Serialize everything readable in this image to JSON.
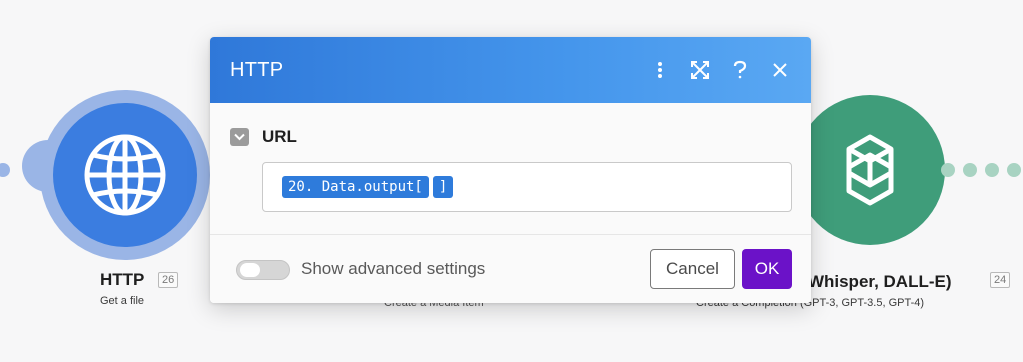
{
  "modules": {
    "http": {
      "title": "HTTP",
      "badge": "26",
      "subtitle": "Get a file"
    },
    "middle": {
      "subtitle": "Create a Media Item"
    },
    "openai": {
      "title_visible": "T, Whisper, DALL-E)",
      "badge": "24",
      "subtitle": "Create a Completion (GPT-3, GPT-3.5, GPT-4)"
    }
  },
  "dialog": {
    "title": "HTTP",
    "icons": [
      "more-vert-icon",
      "expand-icon",
      "help-icon",
      "close-icon"
    ],
    "field": {
      "label": "URL",
      "pills": [
        "20. Data.output[",
        "]"
      ]
    },
    "advanced_label": "Show advanced settings",
    "advanced_enabled": false,
    "cancel_label": "Cancel",
    "ok_label": "OK"
  },
  "colors": {
    "header": "#3b86e3",
    "ok": "#6b12c8",
    "http_module": "#3b7de0",
    "openai_module": "#3f9d7a"
  }
}
